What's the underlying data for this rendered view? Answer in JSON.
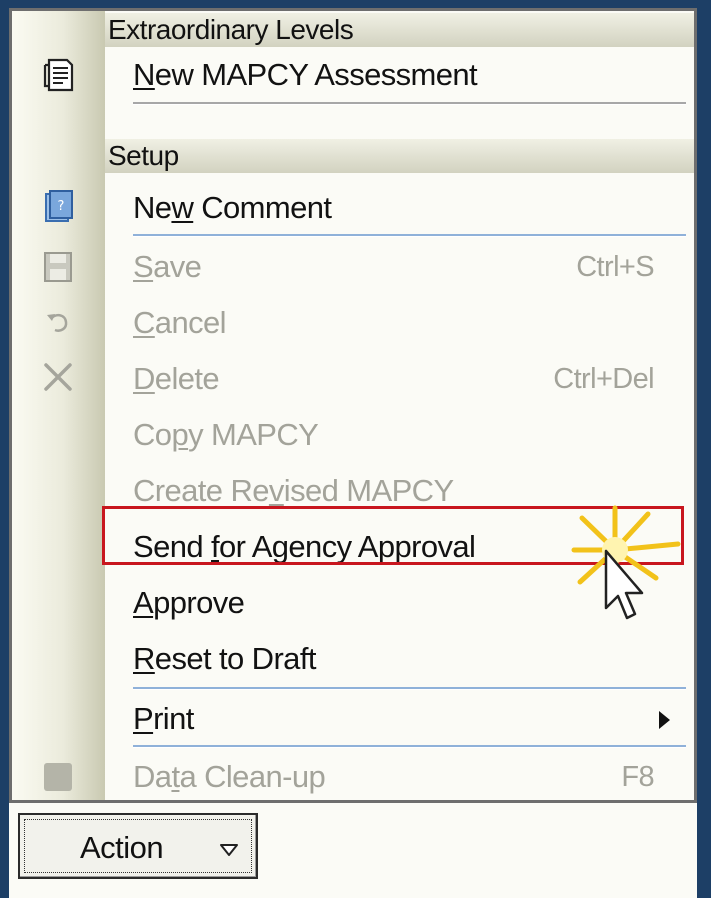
{
  "menu": {
    "sections": [
      {
        "header": "Extraordinary Levels"
      },
      {
        "header": "Setup"
      }
    ],
    "items": [
      {
        "pre": "",
        "mn": "N",
        "post": "ew MAPCY Assessment",
        "shortcut": "",
        "enabled": true,
        "icon": "assessment-icon"
      },
      {
        "pre": "Ne",
        "mn": "w",
        "post": " Comment",
        "shortcut": "",
        "enabled": true,
        "icon": "comment-icon"
      },
      {
        "pre": "",
        "mn": "S",
        "post": "ave",
        "shortcut": "Ctrl+S",
        "enabled": false,
        "icon": "save-icon"
      },
      {
        "pre": "",
        "mn": "C",
        "post": "ancel",
        "shortcut": "",
        "enabled": false,
        "icon": "undo-icon"
      },
      {
        "pre": "",
        "mn": "D",
        "post": "elete",
        "shortcut": "Ctrl+Del",
        "enabled": false,
        "icon": "delete-icon"
      },
      {
        "pre": "Co",
        "mn": "p",
        "post": "y MAPCY",
        "shortcut": "",
        "enabled": false
      },
      {
        "pre": "Create Re",
        "mn": "v",
        "post": "ised MAPCY",
        "shortcut": "",
        "enabled": false
      },
      {
        "pre": "Send ",
        "mn": "f",
        "post": "or Agency Approval",
        "shortcut": "",
        "enabled": true,
        "highlighted": true
      },
      {
        "pre": "",
        "mn": "A",
        "post": "pprove",
        "shortcut": "",
        "enabled": true
      },
      {
        "pre": "",
        "mn": "R",
        "post": "eset to Draft",
        "shortcut": "",
        "enabled": true
      },
      {
        "pre": "",
        "mn": "P",
        "post": "rint",
        "shortcut": "",
        "enabled": true,
        "submenu": true
      },
      {
        "pre": "Da",
        "mn": "t",
        "post": "a Clean-up",
        "shortcut": "F8",
        "enabled": false,
        "icon": "cleanup-icon"
      }
    ]
  },
  "action_button": {
    "label": "Action"
  },
  "colors": {
    "highlight": "#c8161e",
    "burst": "#f2c21a",
    "background": "#1d3f66"
  }
}
